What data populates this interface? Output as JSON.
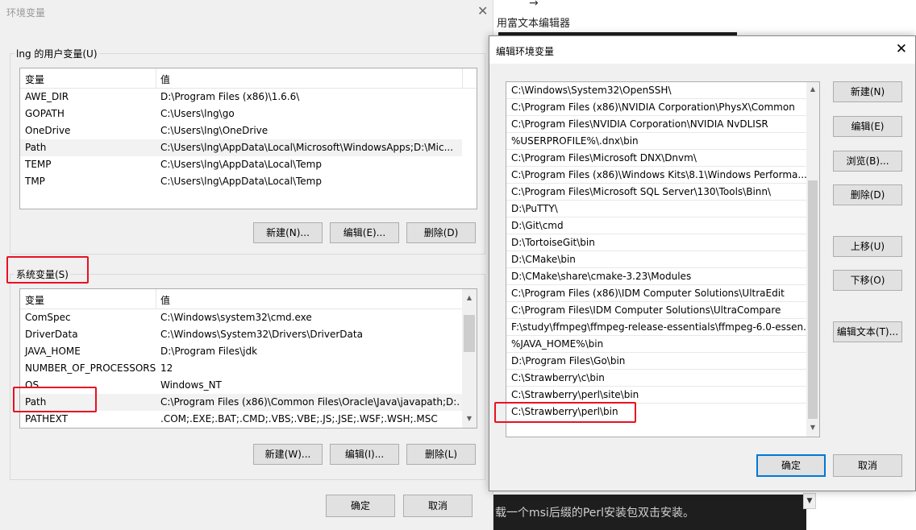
{
  "background": {
    "editor_text": "用富文本编辑器",
    "bottom_text": "载一个msi后缀的Perl安装包双击安装。"
  },
  "env_dialog": {
    "title": "环境变量",
    "user_group_label": "lng 的用户变量(U)",
    "system_group_label": "系统变量(S)",
    "col_var": "变量",
    "col_val": "值",
    "user_vars": [
      {
        "name": "AWE_DIR",
        "value": "D:\\Program Files (x86)\\1.6.6\\"
      },
      {
        "name": "GOPATH",
        "value": "C:\\Users\\lng\\go"
      },
      {
        "name": "OneDrive",
        "value": "C:\\Users\\lng\\OneDrive"
      },
      {
        "name": "Path",
        "value": "C:\\Users\\lng\\AppData\\Local\\Microsoft\\WindowsApps;D:\\Mic..."
      },
      {
        "name": "TEMP",
        "value": "C:\\Users\\lng\\AppData\\Local\\Temp"
      },
      {
        "name": "TMP",
        "value": "C:\\Users\\lng\\AppData\\Local\\Temp"
      }
    ],
    "system_vars": [
      {
        "name": "ComSpec",
        "value": "C:\\Windows\\system32\\cmd.exe"
      },
      {
        "name": "DriverData",
        "value": "C:\\Windows\\System32\\Drivers\\DriverData"
      },
      {
        "name": "JAVA_HOME",
        "value": "D:\\Program Files\\jdk"
      },
      {
        "name": "NUMBER_OF_PROCESSORS",
        "value": "12"
      },
      {
        "name": "OS",
        "value": "Windows_NT"
      },
      {
        "name": "Path",
        "value": "C:\\Program Files (x86)\\Common Files\\Oracle\\Java\\javapath;D:..."
      },
      {
        "name": "PATHEXT",
        "value": ".COM;.EXE;.BAT;.CMD;.VBS;.VBE;.JS;.JSE;.WSF;.WSH;.MSC"
      }
    ],
    "user_buttons": {
      "new": "新建(N)...",
      "edit": "编辑(E)...",
      "delete": "删除(D)"
    },
    "system_buttons": {
      "new": "新建(W)...",
      "edit": "编辑(I)...",
      "delete": "删除(L)"
    },
    "ok": "确定",
    "cancel": "取消"
  },
  "edit_dialog": {
    "title": "编辑环境变量",
    "paths": [
      "C:\\Windows\\System32\\OpenSSH\\",
      "C:\\Program Files (x86)\\NVIDIA Corporation\\PhysX\\Common",
      "C:\\Program Files\\NVIDIA Corporation\\NVIDIA NvDLISR",
      "%USERPROFILE%\\.dnx\\bin",
      "C:\\Program Files\\Microsoft DNX\\Dnvm\\",
      "C:\\Program Files (x86)\\Windows Kits\\8.1\\Windows Performa...",
      "C:\\Program Files\\Microsoft SQL Server\\130\\Tools\\Binn\\",
      "D:\\PuTTY\\",
      "D:\\Git\\cmd",
      "D:\\TortoiseGit\\bin",
      "D:\\CMake\\bin",
      "D:\\CMake\\share\\cmake-3.23\\Modules",
      "C:\\Program Files (x86)\\IDM Computer Solutions\\UltraEdit",
      "C:\\Program Files\\IDM Computer Solutions\\UltraCompare",
      "F:\\study\\ffmpeg\\ffmpeg-release-essentials\\ffmpeg-6.0-essen...",
      "%JAVA_HOME%\\bin",
      "D:\\Program Files\\Go\\bin",
      "C:\\Strawberry\\c\\bin",
      "C:\\Strawberry\\perl\\site\\bin",
      "C:\\Strawberry\\perl\\bin"
    ],
    "buttons": {
      "new": "新建(N)",
      "edit": "编辑(E)",
      "browse": "浏览(B)...",
      "delete": "删除(D)",
      "up": "上移(U)",
      "down": "下移(O)",
      "edit_text": "编辑文本(T)..."
    },
    "ok": "确定",
    "cancel": "取消"
  }
}
